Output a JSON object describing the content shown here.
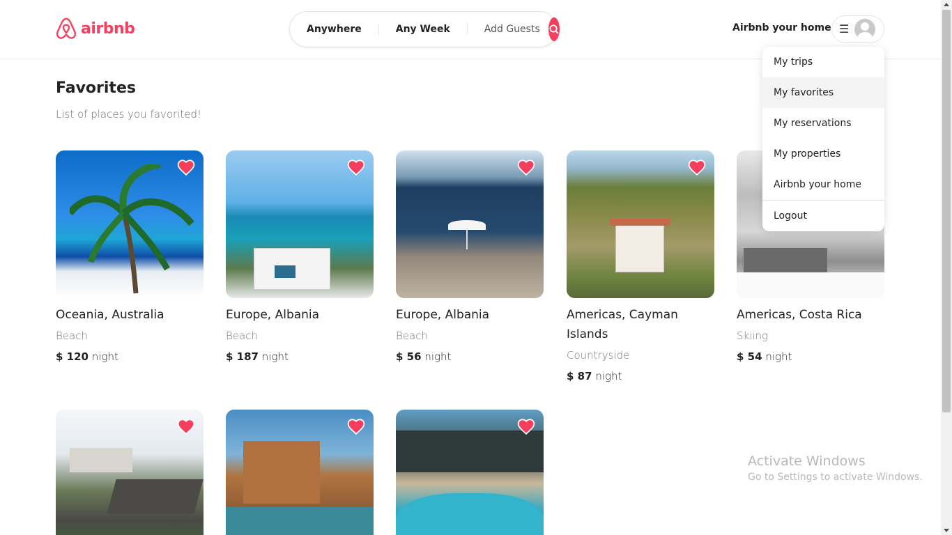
{
  "app": {
    "logo_text": "airbnb",
    "brand_color": "#f43f5e"
  },
  "search": {
    "location": "Anywhere",
    "dates": "Any Week",
    "guests": "Add Guests"
  },
  "header": {
    "host_link": "Airbnb your home"
  },
  "user_menu": {
    "items": [
      {
        "label": "My trips"
      },
      {
        "label": "My favorites"
      },
      {
        "label": "My reservations"
      },
      {
        "label": "My properties"
      },
      {
        "label": "Airbnb your home"
      },
      {
        "label": "Logout"
      }
    ],
    "active_item": "My favorites"
  },
  "page": {
    "title": "Favorites",
    "subtitle": "List of places you favorited!"
  },
  "listings": [
    {
      "location": "Oceania, Australia",
      "category": "Beach",
      "price": "$ 120",
      "unit": "night",
      "favorited": true,
      "image": "palm-beach"
    },
    {
      "location": "Europe, Albania",
      "category": "Beach",
      "price": "$ 187",
      "unit": "night",
      "favorited": true,
      "image": "coastal-villa"
    },
    {
      "location": "Europe, Albania",
      "category": "Beach",
      "price": "$ 56",
      "unit": "night",
      "favorited": true,
      "image": "rocky-shore-umbrella"
    },
    {
      "location": "Americas, Cayman Islands",
      "category": "Countryside",
      "price": "$ 87",
      "unit": "night",
      "favorited": true,
      "image": "countryside-house"
    },
    {
      "location": "Americas, Costa Rica",
      "category": "Skiing",
      "price": "$ 54",
      "unit": "night",
      "favorited": true,
      "image": "snowy-cabin"
    },
    {
      "location": "",
      "category": "",
      "price": "",
      "unit": "",
      "favorited": true,
      "image": "castle-chalet"
    },
    {
      "location": "",
      "category": "",
      "price": "",
      "unit": "",
      "favorited": true,
      "image": "stone-villa-pool"
    },
    {
      "location": "",
      "category": "",
      "price": "",
      "unit": "",
      "favorited": true,
      "image": "modern-villa-pool"
    }
  ],
  "watermark": {
    "line1": "Activate Windows",
    "line2": "Go to Settings to activate Windows."
  }
}
